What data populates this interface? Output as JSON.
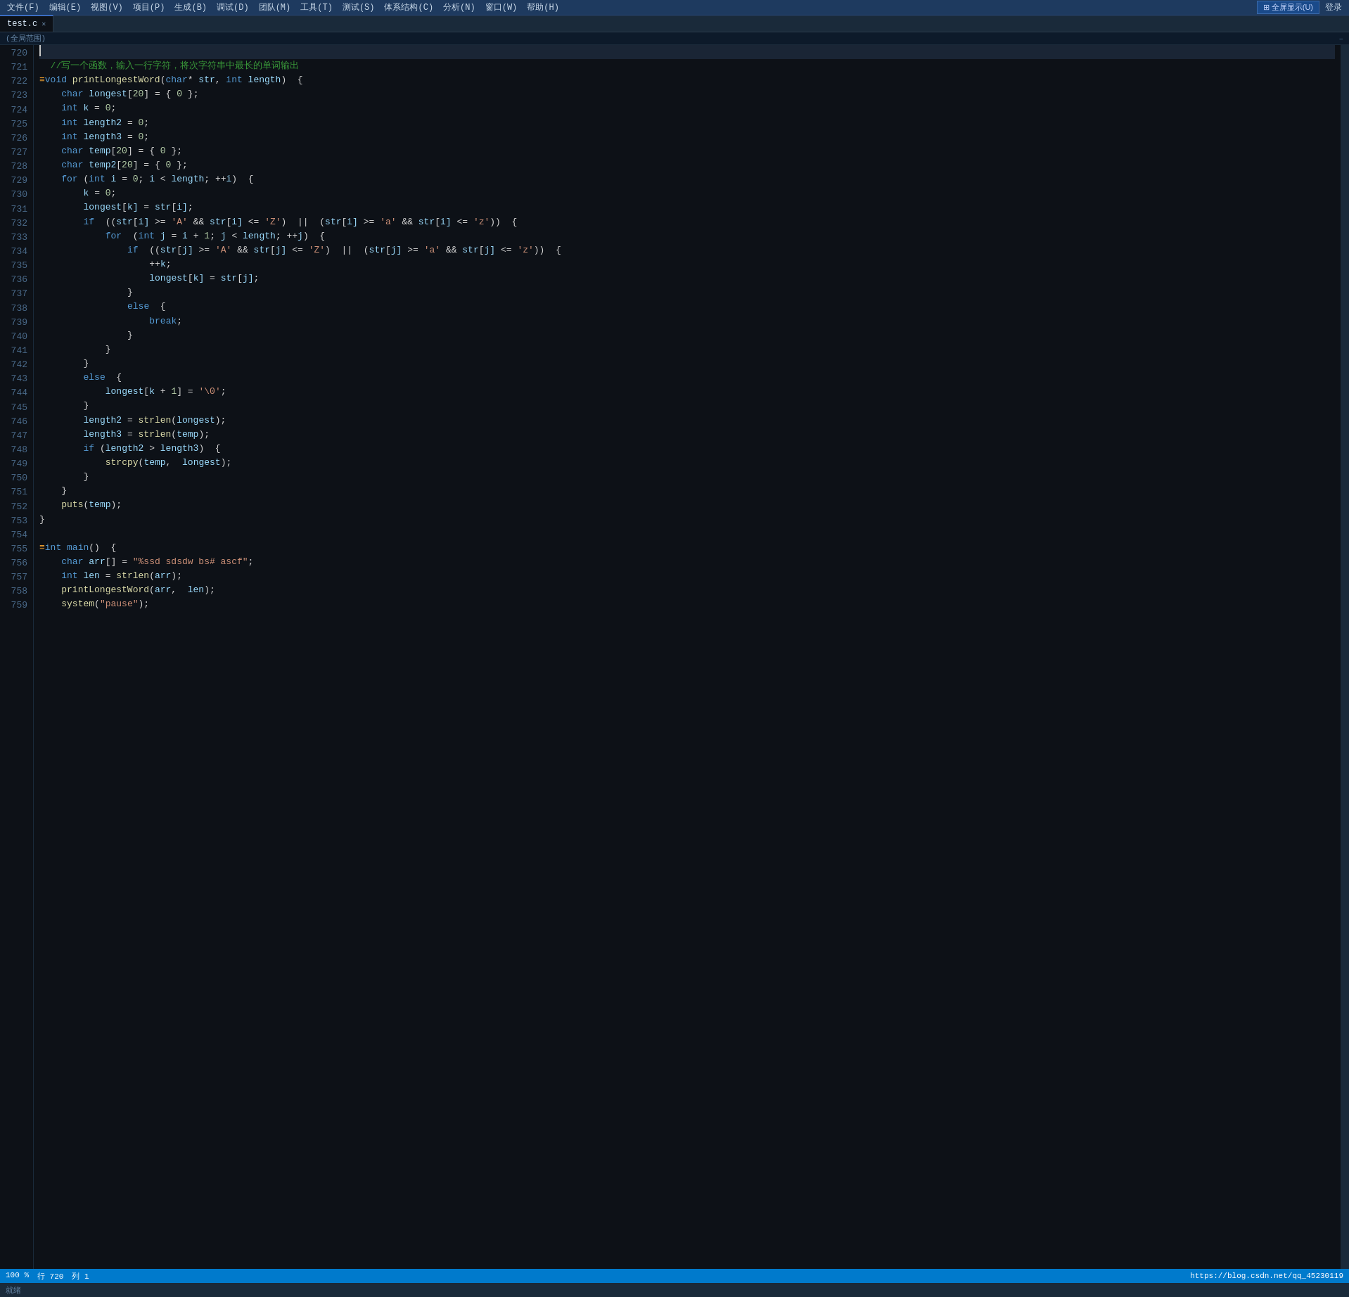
{
  "menubar": {
    "items": [
      "文件(F)",
      "编辑(E)",
      "视图(V)",
      "项目(P)",
      "生成(B)",
      "调试(D)",
      "团队(M)",
      "工具(T)",
      "测试(S)",
      "体系结构(C)",
      "分析(N)",
      "窗口(W)",
      "帮助(H)"
    ],
    "fullscreen": "⊞ 全屏显示(U)",
    "login": "登录"
  },
  "tabs": [
    {
      "label": "test.c",
      "active": true,
      "closable": true
    }
  ],
  "scope": "(全局范围)",
  "status": {
    "left": [
      "100 %",
      "行 720",
      "列 1"
    ],
    "right": "https://blog.csdn.net/qq_45230119",
    "bottom_left": "就绪"
  },
  "lines": [
    {
      "num": 720,
      "content": ""
    },
    {
      "num": 721,
      "content": "  //写一个函数，输入一行字符，将次字符串中最长的单词输出",
      "type": "comment-zh"
    },
    {
      "num": 722,
      "content": "void printLongestWord(char* str, int length)  {",
      "type": "code"
    },
    {
      "num": 723,
      "content": "    char longest[20] = { 0 };",
      "type": "code"
    },
    {
      "num": 724,
      "content": "    int k = 0;",
      "type": "code"
    },
    {
      "num": 725,
      "content": "    int length2 = 0;",
      "type": "code"
    },
    {
      "num": 726,
      "content": "    int length3 = 0;",
      "type": "code"
    },
    {
      "num": 727,
      "content": "    char temp[20] = { 0 };",
      "type": "code"
    },
    {
      "num": 728,
      "content": "    char temp2[20] = { 0 };",
      "type": "code"
    },
    {
      "num": 729,
      "content": "    for (int i = 0; i < length; ++i)  {",
      "type": "code"
    },
    {
      "num": 730,
      "content": "        k = 0;",
      "type": "code"
    },
    {
      "num": 731,
      "content": "        longest[k] = str[i];",
      "type": "code"
    },
    {
      "num": 732,
      "content": "        if  ((str[i] >= 'A' && str[i] <= 'Z')  ||  (str[i] >= 'a' && str[i] <= 'z'))  {",
      "type": "code"
    },
    {
      "num": 733,
      "content": "            for  (int j = i + 1; j < length; ++j)  {",
      "type": "code"
    },
    {
      "num": 734,
      "content": "                if  ((str[j] >= 'A' && str[j] <= 'Z')  ||  (str[j] >= 'a' && str[j] <= 'z'))  {",
      "type": "code"
    },
    {
      "num": 735,
      "content": "                    ++k;",
      "type": "code"
    },
    {
      "num": 736,
      "content": "                    longest[k] = str[j];",
      "type": "code"
    },
    {
      "num": 737,
      "content": "                }",
      "type": "code"
    },
    {
      "num": 738,
      "content": "                else  {",
      "type": "code"
    },
    {
      "num": 739,
      "content": "                    break;",
      "type": "code"
    },
    {
      "num": 740,
      "content": "                }",
      "type": "code"
    },
    {
      "num": 741,
      "content": "            }",
      "type": "code"
    },
    {
      "num": 742,
      "content": "        }",
      "type": "code"
    },
    {
      "num": 743,
      "content": "        else  {",
      "type": "code"
    },
    {
      "num": 744,
      "content": "            longest[k + 1] = '\\0';",
      "type": "code"
    },
    {
      "num": 745,
      "content": "        }",
      "type": "code"
    },
    {
      "num": 746,
      "content": "        length2 = strlen(longest);",
      "type": "code"
    },
    {
      "num": 747,
      "content": "        length3 = strlen(temp);",
      "type": "code"
    },
    {
      "num": 748,
      "content": "        if (length2 > length3)  {",
      "type": "code"
    },
    {
      "num": 749,
      "content": "            strcpy(temp,  longest);",
      "type": "code"
    },
    {
      "num": 750,
      "content": "        }",
      "type": "code"
    },
    {
      "num": 751,
      "content": "    }",
      "type": "code"
    },
    {
      "num": 752,
      "content": "    puts(temp);",
      "type": "code"
    },
    {
      "num": 753,
      "content": "}",
      "type": "code"
    },
    {
      "num": 754,
      "content": "",
      "type": "code"
    },
    {
      "num": 755,
      "content": "int main()  {",
      "type": "code"
    },
    {
      "num": 756,
      "content": "    char arr[] = \"%ssd sdsdw bs# ascf\";",
      "type": "code"
    },
    {
      "num": 757,
      "content": "    int len = strlen(arr);",
      "type": "code"
    },
    {
      "num": 758,
      "content": "    printLongestWord(arr,  len);",
      "type": "code"
    },
    {
      "num": 759,
      "content": "    system(\"pause\");",
      "type": "code"
    }
  ]
}
